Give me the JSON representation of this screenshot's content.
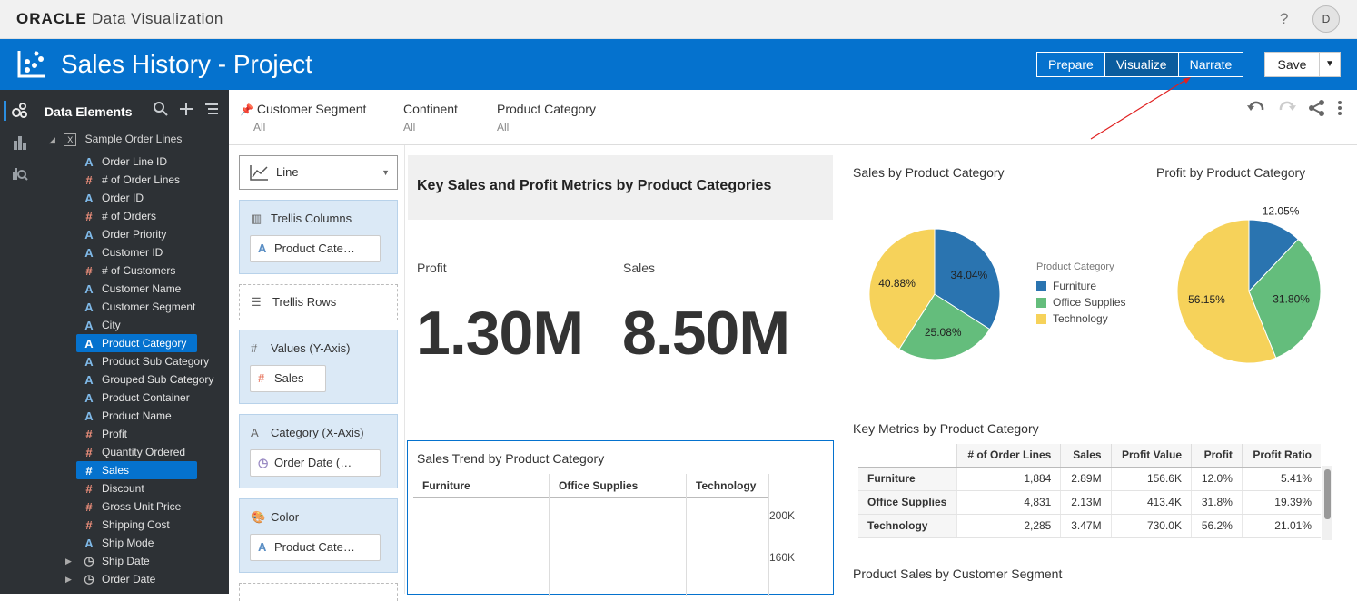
{
  "app": {
    "brand": "ORACLE",
    "product": "Data Visualization",
    "help": "?",
    "user_initial": "D"
  },
  "project": {
    "title": "Sales History - Project"
  },
  "modes": [
    "Prepare",
    "Visualize",
    "Narrate"
  ],
  "active_mode": "Visualize",
  "save": {
    "label": "Save"
  },
  "sidebar": {
    "title": "Data Elements",
    "source": "Sample Order Lines",
    "items": [
      {
        "label": "Order Line ID",
        "type": "A"
      },
      {
        "label": "# of Order Lines",
        "type": "#"
      },
      {
        "label": "Order ID",
        "type": "A"
      },
      {
        "label": "# of Orders",
        "type": "#"
      },
      {
        "label": "Order Priority",
        "type": "A"
      },
      {
        "label": "Customer ID",
        "type": "A"
      },
      {
        "label": "# of Customers",
        "type": "#"
      },
      {
        "label": "Customer Name",
        "type": "A"
      },
      {
        "label": "Customer Segment",
        "type": "A"
      },
      {
        "label": "City",
        "type": "A"
      },
      {
        "label": "Product Category",
        "type": "A",
        "selected": true
      },
      {
        "label": "Product Sub Category",
        "type": "A"
      },
      {
        "label": "Grouped Sub Category",
        "type": "A"
      },
      {
        "label": "Product Container",
        "type": "A"
      },
      {
        "label": "Product Name",
        "type": "A"
      },
      {
        "label": "Profit",
        "type": "#"
      },
      {
        "label": "Quantity Ordered",
        "type": "#"
      },
      {
        "label": "Sales",
        "type": "#",
        "selected": true
      },
      {
        "label": "Discount",
        "type": "#"
      },
      {
        "label": "Gross Unit Price",
        "type": "#"
      },
      {
        "label": "Shipping Cost",
        "type": "#"
      },
      {
        "label": "Ship Mode",
        "type": "A"
      },
      {
        "label": "Ship Date",
        "type": "date",
        "expandable": true
      },
      {
        "label": "Order Date",
        "type": "date",
        "expandable": true
      }
    ]
  },
  "filters": [
    {
      "label": "Customer Segment",
      "value": "All",
      "pinned": true
    },
    {
      "label": "Continent",
      "value": "All"
    },
    {
      "label": "Product Category",
      "value": "All"
    }
  ],
  "grammar": {
    "viz_type": "Line",
    "trellis_columns": {
      "label": "Trellis Columns",
      "pill": "Product Cate…"
    },
    "trellis_rows": {
      "label": "Trellis Rows"
    },
    "values_y": {
      "label": "Values (Y-Axis)",
      "pill": "Sales"
    },
    "category_x": {
      "label": "Category (X-Axis)",
      "pill": "Order Date (…"
    },
    "color": {
      "label": "Color",
      "pill": "Product Cate…"
    }
  },
  "canvas": {
    "title": "Key Sales and Profit Metrics by Product Categories",
    "kpis": [
      {
        "label": "Profit",
        "value": "1.30M"
      },
      {
        "label": "Sales",
        "value": "8.50M"
      }
    ],
    "trend": {
      "title": "Sales Trend by Product Category",
      "columns": [
        "Furniture",
        "Office Supplies",
        "Technology"
      ],
      "y_ticks": [
        "200K",
        "160K"
      ]
    }
  },
  "colors": {
    "Furniture": "#2a74b0",
    "Office Supplies": "#64bd7c",
    "Technology": "#f6d25a",
    "accent": "#0572ce"
  },
  "chart_data": [
    {
      "type": "pie",
      "title": "Sales by Product Category",
      "legend_title": "Product Category",
      "categories": [
        "Furniture",
        "Office Supplies",
        "Technology"
      ],
      "values": [
        34.04,
        25.08,
        40.88
      ],
      "labels": [
        "34.04%",
        "25.08%",
        "40.88%"
      ]
    },
    {
      "type": "pie",
      "title": "Profit by Product Category",
      "categories": [
        "Furniture",
        "Office Supplies",
        "Technology"
      ],
      "values": [
        12.05,
        31.8,
        56.15
      ],
      "labels": [
        "12.05%",
        "31.80%",
        "56.15%"
      ]
    },
    {
      "type": "table",
      "title": "Key Metrics by Product Category",
      "columns": [
        "",
        "# of Order Lines",
        "Sales",
        "Profit Value",
        "Profit",
        "Profit Ratio"
      ],
      "rows": [
        [
          "Furniture",
          "1,884",
          "2.89M",
          "156.6K",
          "12.0%",
          "5.41%"
        ],
        [
          "Office Supplies",
          "4,831",
          "2.13M",
          "413.4K",
          "31.8%",
          "19.39%"
        ],
        [
          "Technology",
          "2,285",
          "3.47M",
          "730.0K",
          "56.2%",
          "21.01%"
        ]
      ]
    }
  ],
  "segment_chart": {
    "title": "Product Sales by Customer Segment"
  }
}
